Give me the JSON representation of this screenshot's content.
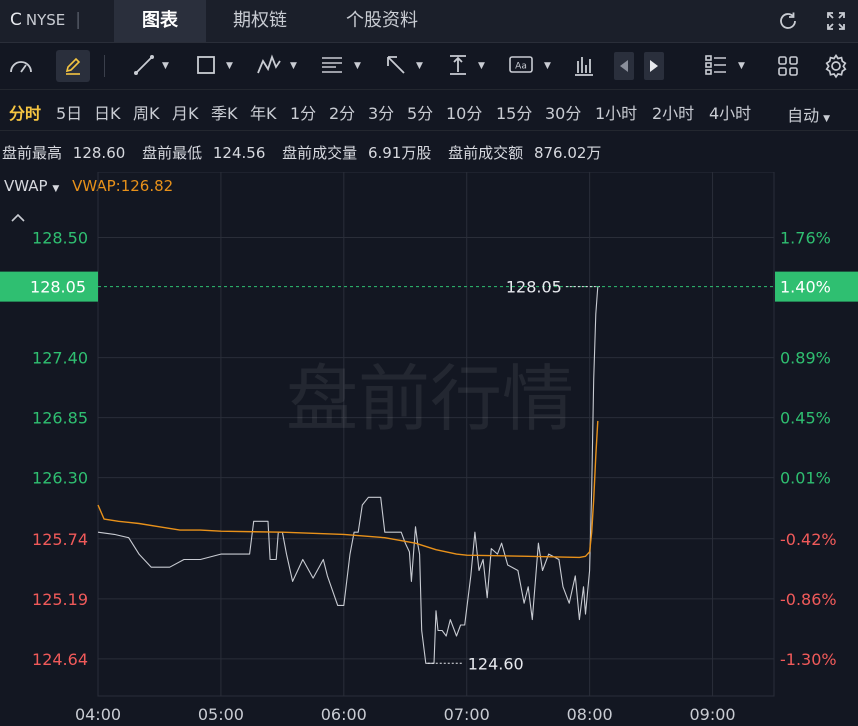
{
  "header": {
    "symbol": "C",
    "exchange": "NYSE",
    "tabs": [
      {
        "label": "图表",
        "active": true
      },
      {
        "label": "期权链",
        "active": false
      },
      {
        "label": "个股资料",
        "active": false
      }
    ],
    "icons": [
      "refresh-icon",
      "fullscreen-icon"
    ]
  },
  "toolbar": {
    "icons": [
      "gauge-icon",
      "pencil-icon",
      "line-tool-icon",
      "rectangle-tool-icon",
      "pattern-tool-icon",
      "fib-tool-icon",
      "arrow-tool-icon",
      "measure-tool-icon",
      "text-tool-icon",
      "bar-chart-icon",
      "prev-icon",
      "next-icon",
      "layout-list-icon",
      "grid-icon",
      "settings-icon"
    ],
    "text_tool_label": "Aa"
  },
  "periods": {
    "items": [
      "分时",
      "5日",
      "日K",
      "周K",
      "月K",
      "季K",
      "年K",
      "1分",
      "2分",
      "3分",
      "5分",
      "10分",
      "15分",
      "30分",
      "1小时",
      "2小时",
      "4小时"
    ],
    "active": "分时",
    "auto_label": "自动"
  },
  "info": {
    "items": [
      {
        "label": "盘前最高",
        "value": "128.60"
      },
      {
        "label": "盘前最低",
        "value": "124.56"
      },
      {
        "label": "盘前成交量",
        "value": "6.91万股"
      },
      {
        "label": "盘前成交额",
        "value": "876.02万"
      }
    ]
  },
  "indicator": {
    "name": "VWAP",
    "value_text": "VWAP:126.82"
  },
  "colors": {
    "up": "#2fbf71",
    "down": "#f05a5a",
    "price_line": "#c8cbd2",
    "vwap_line": "#e8911a",
    "badge": "#2fbf71"
  },
  "chart_data": {
    "type": "line",
    "title": "",
    "watermark": "盘前行情",
    "x_ticks": [
      "04:00",
      "05:00",
      "06:00",
      "07:00",
      "08:00",
      "09:00"
    ],
    "x_range": [
      "04:00",
      "09:30"
    ],
    "ylim": [
      124.3,
      129.1
    ],
    "y_ticks": [
      128.5,
      127.4,
      126.85,
      126.3,
      125.74,
      125.19,
      124.64
    ],
    "y_tick_labels": [
      "128.50",
      "127.40",
      "126.85",
      "126.30",
      "125.74",
      "125.19",
      "124.64"
    ],
    "pct_ticks": [
      {
        "price": 128.5,
        "label": "1.76%"
      },
      {
        "price": 127.4,
        "label": "0.89%"
      },
      {
        "price": 126.85,
        "label": "0.45%"
      },
      {
        "price": 126.3,
        "label": "0.01%"
      },
      {
        "price": 125.74,
        "label": "-0.42%"
      },
      {
        "price": 125.19,
        "label": "-0.86%"
      },
      {
        "price": 124.64,
        "label": "-1.30%"
      }
    ],
    "reference_price": 126.29,
    "current_price": 128.05,
    "current_price_label": "128.05",
    "current_pct_label": "1.40%",
    "max_annotation": {
      "time": "08:04",
      "price": 128.05,
      "label": "128.05"
    },
    "min_annotation": {
      "time": "06:40",
      "price": 124.6,
      "label": "124.60"
    },
    "series": [
      {
        "key": "price",
        "points": [
          [
            "04:00",
            125.8
          ],
          [
            "04:08",
            125.78
          ],
          [
            "04:15",
            125.75
          ],
          [
            "04:20",
            125.6
          ],
          [
            "04:26",
            125.48
          ],
          [
            "04:35",
            125.48
          ],
          [
            "04:42",
            125.55
          ],
          [
            "04:50",
            125.55
          ],
          [
            "05:00",
            125.6
          ],
          [
            "05:10",
            125.6
          ],
          [
            "05:14",
            125.6
          ],
          [
            "05:16",
            125.9
          ],
          [
            "05:23",
            125.9
          ],
          [
            "05:24",
            125.55
          ],
          [
            "05:27",
            125.55
          ],
          [
            "05:28",
            125.8
          ],
          [
            "05:30",
            125.8
          ],
          [
            "05:32",
            125.6
          ],
          [
            "05:35",
            125.35
          ],
          [
            "05:40",
            125.55
          ],
          [
            "05:45",
            125.38
          ],
          [
            "05:50",
            125.55
          ],
          [
            "05:52",
            125.4
          ],
          [
            "05:57",
            125.13
          ],
          [
            "06:00",
            125.13
          ],
          [
            "06:03",
            125.6
          ],
          [
            "06:05",
            125.8
          ],
          [
            "06:07",
            125.8
          ],
          [
            "06:09",
            126.05
          ],
          [
            "06:12",
            126.12
          ],
          [
            "06:18",
            126.12
          ],
          [
            "06:20",
            125.8
          ],
          [
            "06:28",
            125.8
          ],
          [
            "06:30",
            125.7
          ],
          [
            "06:32",
            125.62
          ],
          [
            "06:33",
            125.35
          ],
          [
            "06:35",
            125.85
          ],
          [
            "06:36",
            125.7
          ],
          [
            "06:37",
            125.6
          ],
          [
            "06:38",
            124.9
          ],
          [
            "06:40",
            124.6
          ],
          [
            "06:42",
            124.6
          ],
          [
            "06:44",
            124.6
          ],
          [
            "06:45",
            125.08
          ],
          [
            "06:46",
            124.9
          ],
          [
            "06:48",
            124.9
          ],
          [
            "06:50",
            124.85
          ],
          [
            "06:52",
            125.0
          ],
          [
            "06:55",
            124.85
          ],
          [
            "06:57",
            124.95
          ],
          [
            "06:59",
            124.95
          ],
          [
            "07:00",
            125.1
          ],
          [
            "07:02",
            125.4
          ],
          [
            "07:04",
            125.8
          ],
          [
            "07:06",
            125.45
          ],
          [
            "07:08",
            125.55
          ],
          [
            "07:10",
            125.2
          ],
          [
            "07:12",
            125.65
          ],
          [
            "07:15",
            125.6
          ],
          [
            "07:17",
            125.7
          ],
          [
            "07:20",
            125.5
          ],
          [
            "07:25",
            125.45
          ],
          [
            "07:28",
            125.15
          ],
          [
            "07:30",
            125.3
          ],
          [
            "07:32",
            125.0
          ],
          [
            "07:35",
            125.7
          ],
          [
            "07:37",
            125.45
          ],
          [
            "07:40",
            125.6
          ],
          [
            "07:45",
            125.55
          ],
          [
            "07:47",
            125.3
          ],
          [
            "07:50",
            125.15
          ],
          [
            "07:53",
            125.4
          ],
          [
            "07:55",
            125.0
          ],
          [
            "07:57",
            125.3
          ],
          [
            "07:58",
            125.05
          ],
          [
            "08:00",
            125.45
          ],
          [
            "08:01",
            126.2
          ],
          [
            "08:02",
            127.2
          ],
          [
            "08:03",
            127.8
          ],
          [
            "08:04",
            128.05
          ],
          [
            "08:05",
            128.05
          ]
        ]
      },
      {
        "key": "vwap",
        "points": [
          [
            "04:00",
            126.05
          ],
          [
            "04:03",
            125.92
          ],
          [
            "04:10",
            125.9
          ],
          [
            "04:20",
            125.88
          ],
          [
            "04:30",
            125.85
          ],
          [
            "04:40",
            125.82
          ],
          [
            "04:50",
            125.82
          ],
          [
            "05:00",
            125.81
          ],
          [
            "05:30",
            125.8
          ],
          [
            "06:00",
            125.78
          ],
          [
            "06:20",
            125.75
          ],
          [
            "06:35",
            125.7
          ],
          [
            "06:45",
            125.64
          ],
          [
            "06:55",
            125.6
          ],
          [
            "07:00",
            125.59
          ],
          [
            "07:30",
            125.58
          ],
          [
            "07:55",
            125.57
          ],
          [
            "07:58",
            125.58
          ],
          [
            "08:00",
            125.62
          ],
          [
            "08:01",
            125.8
          ],
          [
            "08:02",
            126.1
          ],
          [
            "08:03",
            126.5
          ],
          [
            "08:04",
            126.82
          ]
        ]
      }
    ]
  }
}
